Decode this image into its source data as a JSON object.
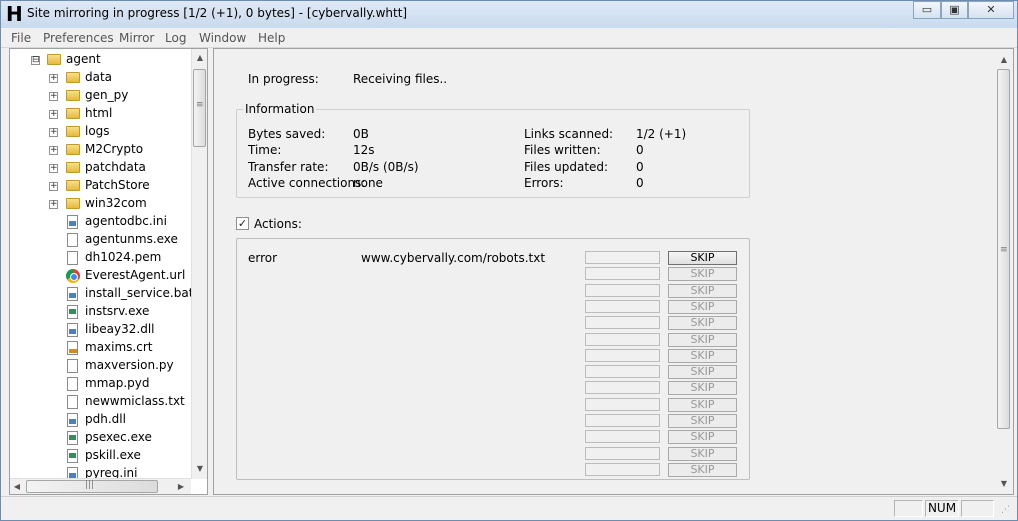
{
  "window": {
    "title": "Site mirroring in progress [1/2 (+1), 0 bytes] - [cybervally.whtt]",
    "app_icon_letter": "H",
    "min_label": "▭",
    "max_label": "▣",
    "close_label": "✕"
  },
  "menu": [
    "File",
    "Preferences",
    "Mirror",
    "Log",
    "Window",
    "Help"
  ],
  "tree": {
    "root": {
      "label": "agent",
      "icon": "folder-icon",
      "expander": "⊟"
    },
    "folders": [
      {
        "label": "data"
      },
      {
        "label": "gen_py"
      },
      {
        "label": "html"
      },
      {
        "label": "logs"
      },
      {
        "label": "M2Crypto"
      },
      {
        "label": "patchdata"
      },
      {
        "label": "PatchStore"
      },
      {
        "label": "win32com"
      }
    ],
    "files": [
      {
        "label": "agentodbc.ini",
        "icon": "ini-file-icon"
      },
      {
        "label": "agentunms.exe",
        "icon": "py-file-icon"
      },
      {
        "label": "dh1024.pem",
        "icon": "file-icon"
      },
      {
        "label": "EverestAgent.url",
        "icon": "chrome-icon"
      },
      {
        "label": "install_service.bat",
        "icon": "bat-file-icon"
      },
      {
        "label": "instsrv.exe",
        "icon": "exe-file-icon"
      },
      {
        "label": "libeay32.dll",
        "icon": "dll-file-icon"
      },
      {
        "label": "maxims.crt",
        "icon": "cert-file-icon"
      },
      {
        "label": "maxversion.py",
        "icon": "file-icon"
      },
      {
        "label": "mmap.pyd",
        "icon": "file-icon"
      },
      {
        "label": "newwmiclass.txt",
        "icon": "txt-file-icon"
      },
      {
        "label": "pdh.dll",
        "icon": "dll-file-icon"
      },
      {
        "label": "psexec.exe",
        "icon": "exe-file-icon"
      },
      {
        "label": "pskill.exe",
        "icon": "exe-file-icon"
      },
      {
        "label": "pyreg.ini",
        "icon": "ini-file-icon"
      }
    ]
  },
  "progress": {
    "label": "In progress:",
    "value": "Receiving files.."
  },
  "information": {
    "title": "Information",
    "left": [
      {
        "label": "Bytes saved:",
        "value": "0B"
      },
      {
        "label": "Time:",
        "value": "12s"
      },
      {
        "label": "Transfer rate:",
        "value": "0B/s (0B/s)"
      },
      {
        "label": "Active connections:",
        "value": "none"
      }
    ],
    "right": [
      {
        "label": "Links scanned:",
        "value": "1/2 (+1)"
      },
      {
        "label": "Files written:",
        "value": "0"
      },
      {
        "label": "Files updated:",
        "value": "0"
      },
      {
        "label": "Errors:",
        "value": "0"
      }
    ]
  },
  "actions": {
    "checkbox_label": "Actions:",
    "checked": true,
    "rows": [
      {
        "status": "error",
        "url": "www.cybervally.com/robots.txt",
        "skip": "SKIP",
        "enabled": true
      },
      {
        "status": "",
        "url": "",
        "skip": "SKIP",
        "enabled": false
      },
      {
        "status": "",
        "url": "",
        "skip": "SKIP",
        "enabled": false
      },
      {
        "status": "",
        "url": "",
        "skip": "SKIP",
        "enabled": false
      },
      {
        "status": "",
        "url": "",
        "skip": "SKIP",
        "enabled": false
      },
      {
        "status": "",
        "url": "",
        "skip": "SKIP",
        "enabled": false
      },
      {
        "status": "",
        "url": "",
        "skip": "SKIP",
        "enabled": false
      },
      {
        "status": "",
        "url": "",
        "skip": "SKIP",
        "enabled": false
      },
      {
        "status": "",
        "url": "",
        "skip": "SKIP",
        "enabled": false
      },
      {
        "status": "",
        "url": "",
        "skip": "SKIP",
        "enabled": false
      },
      {
        "status": "",
        "url": "",
        "skip": "SKIP",
        "enabled": false
      },
      {
        "status": "",
        "url": "",
        "skip": "SKIP",
        "enabled": false
      },
      {
        "status": "",
        "url": "",
        "skip": "SKIP",
        "enabled": false
      },
      {
        "status": "",
        "url": "",
        "skip": "SKIP",
        "enabled": false
      }
    ]
  },
  "statusbar": {
    "num": "NUM"
  },
  "scroll": {
    "up": "▲",
    "down": "▼",
    "left": "◀",
    "right": "▶",
    "grip_v": "≡",
    "grip_h": "|||"
  }
}
